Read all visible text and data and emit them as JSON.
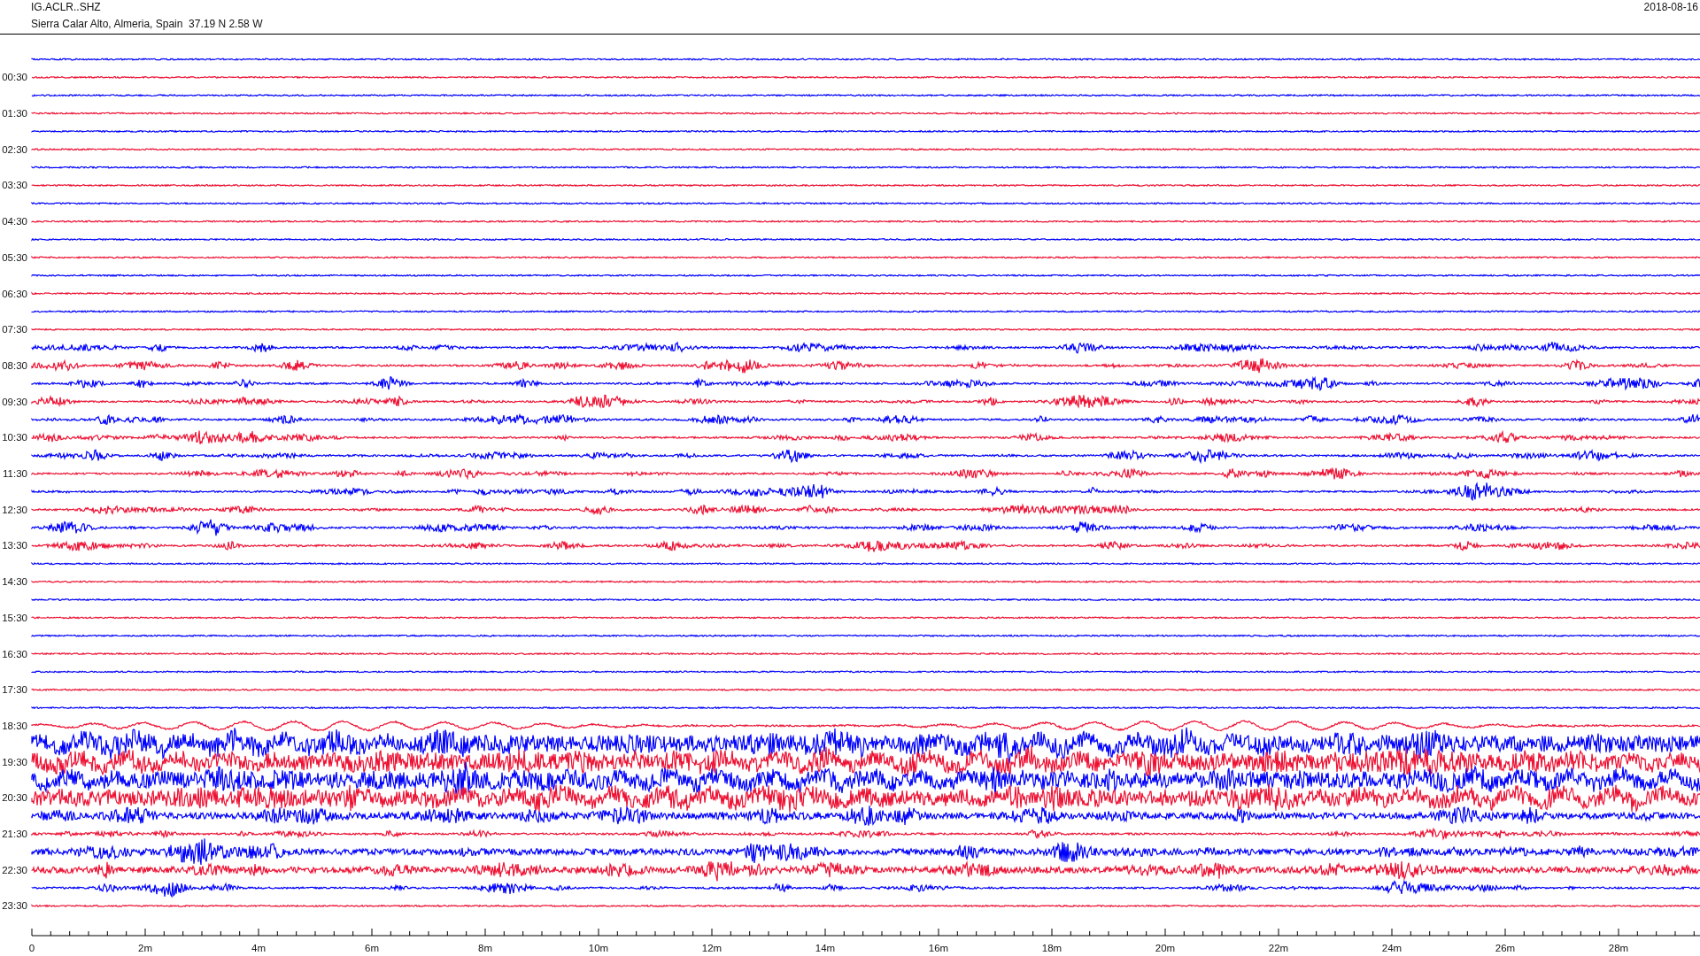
{
  "header": {
    "station": "IG.ACLR..SHZ",
    "location": "Sierra Calar Alto, Almeria, Spain  37.19 N 2.58 W",
    "date": "2018-08-16"
  },
  "traces": [
    {
      "color": "#0000ff",
      "kind": "quiet"
    },
    {
      "color": "#ee1133",
      "kind": "quiet",
      "label": "00:30"
    },
    {
      "color": "#0000ff",
      "kind": "quiet"
    },
    {
      "color": "#ee1133",
      "kind": "quiet",
      "label": "01:30"
    },
    {
      "color": "#0000ff",
      "kind": "quiet"
    },
    {
      "color": "#ee1133",
      "kind": "quiet",
      "label": "02:30"
    },
    {
      "color": "#0000ff",
      "kind": "quiet"
    },
    {
      "color": "#ee1133",
      "kind": "quiet",
      "label": "03:30"
    },
    {
      "color": "#0000ff",
      "kind": "quiet"
    },
    {
      "color": "#ee1133",
      "kind": "quiet",
      "label": "04:30"
    },
    {
      "color": "#0000ff",
      "kind": "quiet"
    },
    {
      "color": "#ee1133",
      "kind": "quiet",
      "label": "05:30"
    },
    {
      "color": "#0000ff",
      "kind": "quiet"
    },
    {
      "color": "#ee1133",
      "kind": "quiet",
      "label": "06:30"
    },
    {
      "color": "#0000ff",
      "kind": "quiet"
    },
    {
      "color": "#ee1133",
      "kind": "quiet",
      "label": "07:30"
    },
    {
      "color": "#0000ff",
      "kind": "bursty"
    },
    {
      "color": "#ee1133",
      "kind": "bursty",
      "label": "08:30"
    },
    {
      "color": "#0000ff",
      "kind": "bursty"
    },
    {
      "color": "#ee1133",
      "kind": "bursty",
      "label": "09:30"
    },
    {
      "color": "#0000ff",
      "kind": "bursty"
    },
    {
      "color": "#ee1133",
      "kind": "bursty",
      "label": "10:30"
    },
    {
      "color": "#0000ff",
      "kind": "bursty"
    },
    {
      "color": "#ee1133",
      "kind": "bursty",
      "label": "11:30"
    },
    {
      "color": "#0000ff",
      "kind": "bursty"
    },
    {
      "color": "#ee1133",
      "kind": "bursty",
      "label": "12:30"
    },
    {
      "color": "#0000ff",
      "kind": "bursty"
    },
    {
      "color": "#ee1133",
      "kind": "bursty",
      "label": "13:30"
    },
    {
      "color": "#0000ff",
      "kind": "quiet"
    },
    {
      "color": "#ee1133",
      "kind": "quiet",
      "label": "14:30"
    },
    {
      "color": "#0000ff",
      "kind": "quiet"
    },
    {
      "color": "#ee1133",
      "kind": "quiet",
      "label": "15:30"
    },
    {
      "color": "#0000ff",
      "kind": "quiet"
    },
    {
      "color": "#ee1133",
      "kind": "quiet",
      "label": "16:30"
    },
    {
      "color": "#0000ff",
      "kind": "quiet"
    },
    {
      "color": "#ee1133",
      "kind": "quiet",
      "label": "17:30"
    },
    {
      "color": "#0000ff",
      "kind": "quiet"
    },
    {
      "color": "#ee1133",
      "kind": "wavy",
      "label": "18:30"
    },
    {
      "color": "#0000ff",
      "kind": "extreme"
    },
    {
      "color": "#ee1133",
      "kind": "extreme",
      "label": "19:30"
    },
    {
      "color": "#0000ff",
      "kind": "extreme"
    },
    {
      "color": "#ee1133",
      "kind": "extreme",
      "label": "20:30"
    },
    {
      "color": "#0000ff",
      "kind": "loud"
    },
    {
      "color": "#ee1133",
      "kind": "bursty",
      "label": "21:30"
    },
    {
      "color": "#0000ff",
      "kind": "loud"
    },
    {
      "color": "#ee1133",
      "kind": "loud",
      "label": "22:30"
    },
    {
      "color": "#0000ff",
      "kind": "bursty"
    },
    {
      "color": "#ee1133",
      "kind": "quiet",
      "label": "23:30"
    }
  ],
  "time_axis": {
    "ticks": [
      "0",
      "2m",
      "4m",
      "6m",
      "8m",
      "10m",
      "12m",
      "14m",
      "16m",
      "18m",
      "20m",
      "22m",
      "24m",
      "26m",
      "28m"
    ]
  }
}
